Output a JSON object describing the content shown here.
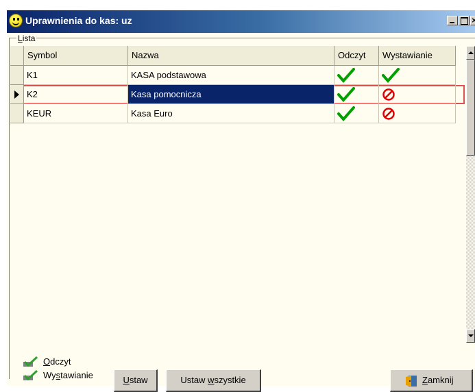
{
  "window": {
    "title": "Uprawnienia do kas:  uz",
    "icon": "smiley-icon",
    "controls": {
      "minimize": "_",
      "maximize": "□",
      "close": "×"
    }
  },
  "group": {
    "label_prefix": "L",
    "label_rest": "ista"
  },
  "grid": {
    "columns": [
      "Symbol",
      "Nazwa",
      "Odczyt",
      "Wystawianie"
    ],
    "rows": [
      {
        "symbol": "K1",
        "nazwa": "KASA podstawowa",
        "odczyt": "check",
        "wystawianie": "check",
        "current": false
      },
      {
        "symbol": "K2",
        "nazwa": "Kasa pomocnicza",
        "odczyt": "check",
        "wystawianie": "forbidden",
        "current": true
      },
      {
        "symbol": "KEUR",
        "nazwa": "Kasa Euro",
        "odczyt": "check",
        "wystawianie": "forbidden",
        "current": false
      }
    ]
  },
  "legend": {
    "odczyt_prefix": "O",
    "odczyt_rest": "dczyt",
    "wyst_a": "Wy",
    "wyst_u": "s",
    "wyst_b": "tawianie"
  },
  "buttons": {
    "ustaw_u": "U",
    "ustaw_rest": "staw",
    "ustaw_all_a": "Ustaw ",
    "ustaw_all_u": "w",
    "ustaw_all_b": "szystkie",
    "zamknij_u": "Z",
    "zamknij_rest": "amknij"
  },
  "colors": {
    "title_start": "#0a246a",
    "title_end": "#a6caf0",
    "background": "#fffdf0",
    "selection": "#0a246a",
    "check": "#00a000",
    "forbidden": "#e00000",
    "current_row_border": "#e05050"
  }
}
